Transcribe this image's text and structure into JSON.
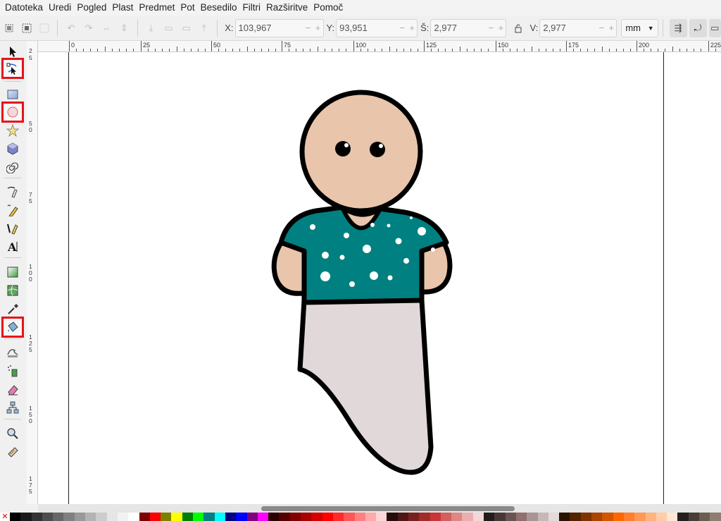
{
  "menu": [
    "Datoteka",
    "Uredi",
    "Pogled",
    "Plast",
    "Predmet",
    "Pot",
    "Besedilo",
    "Filtri",
    "Razširitve",
    "Pomoč"
  ],
  "toolbar": {
    "x_label": "X:",
    "x_value": "103,967",
    "y_label": "Y:",
    "y_value": "93,951",
    "w_label": "Š:",
    "w_value": "2,977",
    "h_label": "V:",
    "h_value": "2,977",
    "unit": "mm",
    "minus": "−",
    "plus": "+"
  },
  "hruler_labels": [
    "0",
    "25",
    "50",
    "75",
    "100",
    "125",
    "150",
    "175",
    "200",
    "225"
  ],
  "vruler_labels": [
    "2",
    "5",
    "5",
    "0",
    "7",
    "5",
    "1",
    "0",
    "0",
    "1",
    "2",
    "5",
    "1",
    "5",
    "0",
    "1",
    "7",
    "5"
  ],
  "tools": [
    {
      "name": "selector-tool",
      "highlight": false
    },
    {
      "name": "node-tool",
      "highlight": true
    },
    {
      "name": "rectangle-tool",
      "highlight": false
    },
    {
      "name": "ellipse-tool",
      "highlight": true
    },
    {
      "name": "star-tool",
      "highlight": false
    },
    {
      "name": "3d-box-tool",
      "highlight": false
    },
    {
      "name": "spiral-tool",
      "highlight": false
    },
    {
      "name": "pen-tool",
      "highlight": false
    },
    {
      "name": "pencil-tool",
      "highlight": false
    },
    {
      "name": "calligraphy-tool",
      "highlight": false
    },
    {
      "name": "text-tool",
      "highlight": false
    },
    {
      "name": "gradient-tool",
      "highlight": false
    },
    {
      "name": "mesh-tool",
      "highlight": false
    },
    {
      "name": "dropper-tool",
      "highlight": false
    },
    {
      "name": "paint-bucket-tool",
      "highlight": true
    },
    {
      "name": "tweak-tool",
      "highlight": false
    },
    {
      "name": "spray-tool",
      "highlight": false
    },
    {
      "name": "eraser-tool",
      "highlight": false
    },
    {
      "name": "connector-tool",
      "highlight": false
    },
    {
      "name": "zoom-tool",
      "highlight": false
    },
    {
      "name": "measure-tool",
      "highlight": false
    }
  ],
  "colors": {
    "skin": "#e8c5ab",
    "shirt": "#008080",
    "skirt": "#e0d8d9",
    "outline": "#000000",
    "highlight_box": "#e8121b"
  },
  "palette": [
    "#000000",
    "#1a1a1a",
    "#333333",
    "#4d4d4d",
    "#666666",
    "#808080",
    "#999999",
    "#b3b3b3",
    "#cccccc",
    "#e6e6e6",
    "#f2f2f2",
    "#ffffff",
    "#800000",
    "#ff0000",
    "#808000",
    "#ffff00",
    "#008000",
    "#00ff00",
    "#008080",
    "#00ffff",
    "#000080",
    "#0000ff",
    "#800080",
    "#ff00ff",
    "#2b0000",
    "#550000",
    "#800000",
    "#aa0000",
    "#d40000",
    "#ff0000",
    "#ff2a2a",
    "#ff5555",
    "#ff8080",
    "#ffaaaa",
    "#ffd5d5",
    "#280b0b",
    "#501616",
    "#782121",
    "#a02c2c",
    "#c83737",
    "#d35f5f",
    "#de8787",
    "#e9afaf",
    "#f4d7d7",
    "#241c1c",
    "#483737",
    "#6c5353",
    "#916f6f",
    "#ac9393",
    "#c8b7b7",
    "#e3dbdb",
    "#2b1100",
    "#552200",
    "#803300",
    "#aa4400",
    "#d45500",
    "#ff6600",
    "#ff7f2a",
    "#ff9955",
    "#ffb380",
    "#ffccaa",
    "#ffe6d5",
    "#241f1c",
    "#483e37",
    "#6c5d53",
    "#917c6f"
  ]
}
